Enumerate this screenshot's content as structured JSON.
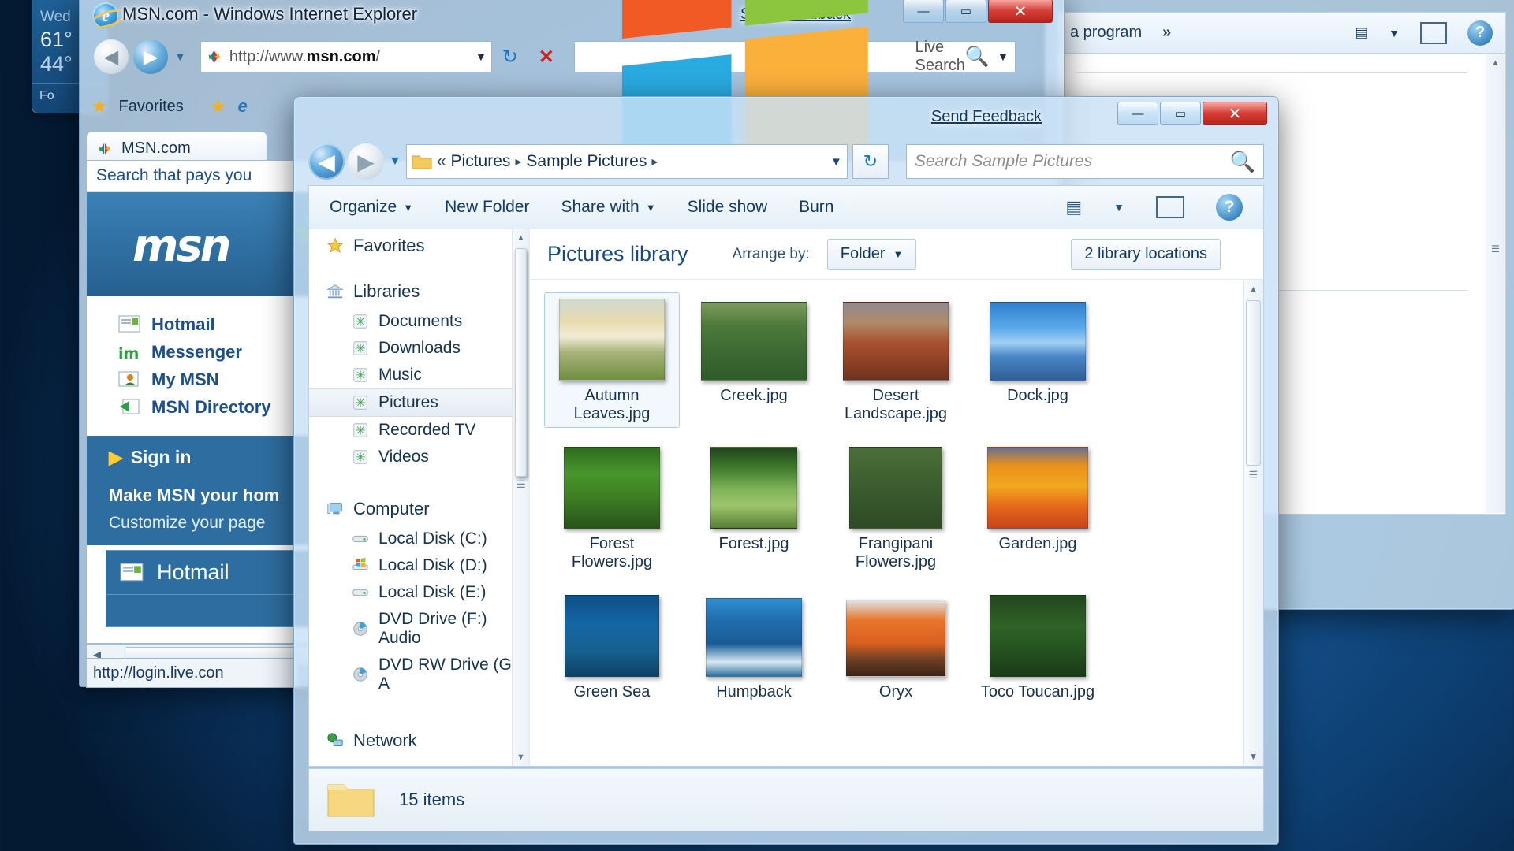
{
  "desktop": {
    "gadget": {
      "name": "weather-gadget",
      "day": "Wed",
      "high": "61°",
      "low": "44°",
      "footer": "Fo"
    }
  },
  "background_window": {
    "toolbar_label": "a program",
    "overflow_chevrons": "»",
    "views_icon": "views-icon",
    "dropdown_caret": "▼",
    "preview_pane_icon": "preview-pane-icon",
    "help_label": "?"
  },
  "ie_window": {
    "title": "MSN.com - Windows Internet Explorer",
    "send_feedback": "Send Feedback",
    "buttons": {
      "minimize": "—",
      "maximize": "▭",
      "close": "✕"
    },
    "address": {
      "prefix": "http://www.",
      "bold": "msn.com",
      "suffix": "/",
      "full": "http://www.msn.com/",
      "dropdown": "▼",
      "refresh_icon": "refresh-icon",
      "stop_icon": "stop-icon"
    },
    "search": {
      "placeholder": "Live Search",
      "go_icon": "search-icon",
      "dropdown": "▼"
    },
    "favorites_bar": {
      "favorites_label": "Favorites",
      "star_icon": "star-icon",
      "add_favorites_icon": "add-to-favorites-icon",
      "suggested_sites_icon": "suggested-sites-icon"
    },
    "tab": {
      "label": "MSN.com",
      "icon": "msn-butterfly-icon"
    },
    "page": {
      "search_tagline": "Search that pays you",
      "logo": "msn",
      "links": [
        {
          "label": "Hotmail",
          "icon": "mail-icon"
        },
        {
          "label": "Messenger",
          "icon": "messenger-icon"
        },
        {
          "label": "My MSN",
          "icon": "my-msn-icon"
        },
        {
          "label": "MSN Directory",
          "icon": "directory-icon"
        }
      ],
      "sign_in": "Sign in",
      "make_home": "Make MSN your hom",
      "customize": "Customize your page",
      "hotmail_box": "Hotmail"
    },
    "status_url": "http://login.live.con"
  },
  "explorer_window": {
    "send_feedback": "Send Feedback",
    "buttons": {
      "minimize": "—",
      "maximize": "▭",
      "close": "✕"
    },
    "breadcrumb": {
      "folder_icon": "folder-icon",
      "overflow": "«",
      "items": [
        "Pictures",
        "Sample Pictures"
      ],
      "separator": "▸",
      "dropdown": "▼",
      "refresh_icon": "refresh-icon"
    },
    "search_placeholder": "Search Sample Pictures",
    "search_icon": "search-icon",
    "toolbar": [
      {
        "label": "Organize",
        "has_caret": true
      },
      {
        "label": "New Folder",
        "has_caret": false
      },
      {
        "label": "Share with",
        "has_caret": true
      },
      {
        "label": "Slide show",
        "has_caret": false
      },
      {
        "label": "Burn",
        "has_caret": false
      }
    ],
    "toolbar_right": {
      "views_icon": "views-icon",
      "views_caret": "▼",
      "preview_pane_icon": "preview-pane-icon",
      "help_label": "?"
    },
    "nav_pane": {
      "groups": [
        {
          "root": "Favorites",
          "root_icon": "star-icon",
          "items": []
        },
        {
          "root": "Libraries",
          "root_icon": "libraries-icon",
          "items": [
            {
              "label": "Documents",
              "icon": "library-icon",
              "selected": false
            },
            {
              "label": "Downloads",
              "icon": "library-icon",
              "selected": false
            },
            {
              "label": "Music",
              "icon": "library-icon",
              "selected": false
            },
            {
              "label": "Pictures",
              "icon": "library-icon",
              "selected": true
            },
            {
              "label": "Recorded TV",
              "icon": "library-icon",
              "selected": false
            },
            {
              "label": "Videos",
              "icon": "library-icon",
              "selected": false
            }
          ]
        },
        {
          "root": "Computer",
          "root_icon": "computer-icon",
          "items": [
            {
              "label": "Local Disk (C:)",
              "icon": "drive-icon",
              "selected": false
            },
            {
              "label": "Local Disk (D:)",
              "icon": "windows-drive-icon",
              "selected": false
            },
            {
              "label": "Local Disk (E:)",
              "icon": "drive-icon",
              "selected": false
            },
            {
              "label": "DVD Drive (F:) Audio",
              "icon": "dvd-icon",
              "selected": false
            },
            {
              "label": "DVD RW Drive (G:) A",
              "icon": "dvd-icon",
              "selected": false
            }
          ]
        },
        {
          "root": "Network",
          "root_icon": "network-icon",
          "items": []
        }
      ]
    },
    "library_header": {
      "title": "Pictures library",
      "arrange_label": "Arrange by:",
      "arrange_value": "Folder",
      "arrange_caret": "▼",
      "locations_button": "2 library locations"
    },
    "files": [
      {
        "name": "Autumn Leaves.jpg",
        "selected": true,
        "kind": "autumn"
      },
      {
        "name": "Creek.jpg",
        "selected": false,
        "kind": "creek"
      },
      {
        "name": "Desert Landscape.jpg",
        "selected": false,
        "kind": "desert"
      },
      {
        "name": "Dock.jpg",
        "selected": false,
        "kind": "dock"
      },
      {
        "name": "Forest Flowers.jpg",
        "selected": false,
        "kind": "forestflowers"
      },
      {
        "name": "Forest.jpg",
        "selected": false,
        "kind": "forest"
      },
      {
        "name": "Frangipani Flowers.jpg",
        "selected": false,
        "kind": "frangipani"
      },
      {
        "name": "Garden.jpg",
        "selected": false,
        "kind": "garden"
      },
      {
        "name": "Green Sea",
        "selected": false,
        "kind": "greensea"
      },
      {
        "name": "Humpback",
        "selected": false,
        "kind": "humpback"
      },
      {
        "name": "Oryx",
        "selected": false,
        "kind": "oryx"
      },
      {
        "name": "Toco Toucan.jpg",
        "selected": false,
        "kind": "toucan"
      }
    ],
    "status": {
      "folder_icon": "folder-icon",
      "item_count": "15 items"
    }
  },
  "colors": {
    "aero_glass": "#c8e1f5",
    "accent_blue": "#1c63a8",
    "close_red": "#d63f36",
    "selection_blue": "#a8cdea",
    "desktop_blue": "#14518b"
  }
}
